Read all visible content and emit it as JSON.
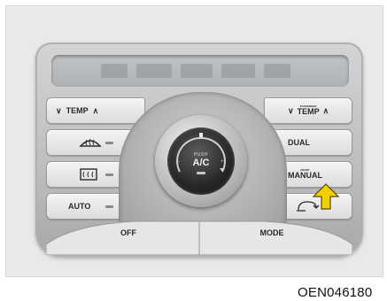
{
  "caption": "OEN046180",
  "panel": {
    "left_buttons": [
      {
        "label": "TEMP",
        "prefix": "∨",
        "suffix": "∧"
      },
      {
        "label": "",
        "icon": "front-defrost-icon"
      },
      {
        "label": "",
        "icon": "rear-defrost-icon"
      },
      {
        "label": "AUTO"
      }
    ],
    "right_buttons": [
      {
        "label": "TEMP",
        "prefix": "∨",
        "suffix": "∧",
        "small": "PASSENGER"
      },
      {
        "label": "DUAL"
      },
      {
        "label": "MANUAL",
        "small": "FRONT",
        "indicator_on": true
      },
      {
        "label": "",
        "icon": "recirculation-icon"
      }
    ],
    "knob": {
      "label": "A/C",
      "small": "PUSH"
    },
    "bottom": {
      "off": "OFF",
      "mode": "MODE"
    }
  },
  "colors": {
    "indicator_on": "#f2d21a",
    "arrow": "#f0d000"
  }
}
